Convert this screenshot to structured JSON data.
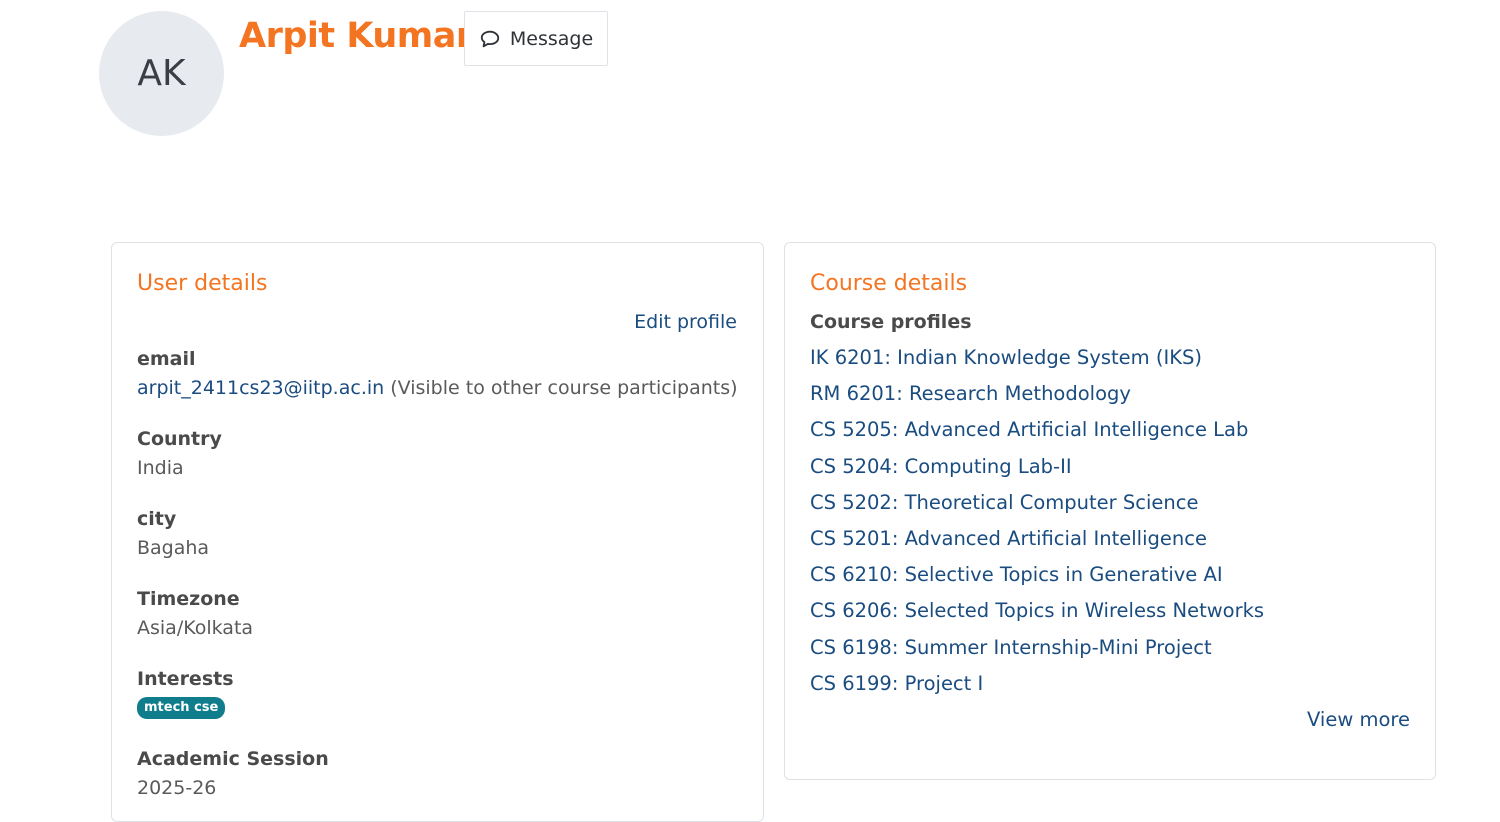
{
  "profile": {
    "initials": "AK",
    "name": "Arpit Kumar",
    "message_label": "Message"
  },
  "user_details": {
    "title": "User details",
    "edit_label": "Edit profile",
    "email": {
      "label": "email",
      "value": "arpit_2411cs23@iitp.ac.in",
      "note": " (Visible to other course participants)"
    },
    "country": {
      "label": "Country",
      "value": "India"
    },
    "city": {
      "label": "city",
      "value": "Bagaha"
    },
    "timezone": {
      "label": "Timezone",
      "value": "Asia/Kolkata"
    },
    "interests": {
      "label": "Interests",
      "tag": "mtech cse"
    },
    "academic_session": {
      "label": "Academic Session",
      "value": "2025-26"
    }
  },
  "course_details": {
    "title": "Course details",
    "profiles_label": "Course profiles",
    "courses": [
      "IK 6201: Indian Knowledge System (IKS)",
      "RM 6201: Research Methodology",
      "CS 5205: Advanced Artificial Intelligence Lab",
      "CS 5204: Computing Lab-II",
      "CS 5202: Theoretical Computer Science",
      "CS 5201: Advanced Artificial Intelligence",
      "CS 6210: Selective Topics in Generative AI",
      "CS 6206: Selected Topics in Wireless Networks",
      "CS 6198: Summer Internship-Mini Project",
      "CS 6199: Project I"
    ],
    "view_more_label": "View more"
  },
  "colors": {
    "accent": "#f47521",
    "link": "#1a4c80",
    "tag_bg": "#0f7d8c"
  }
}
